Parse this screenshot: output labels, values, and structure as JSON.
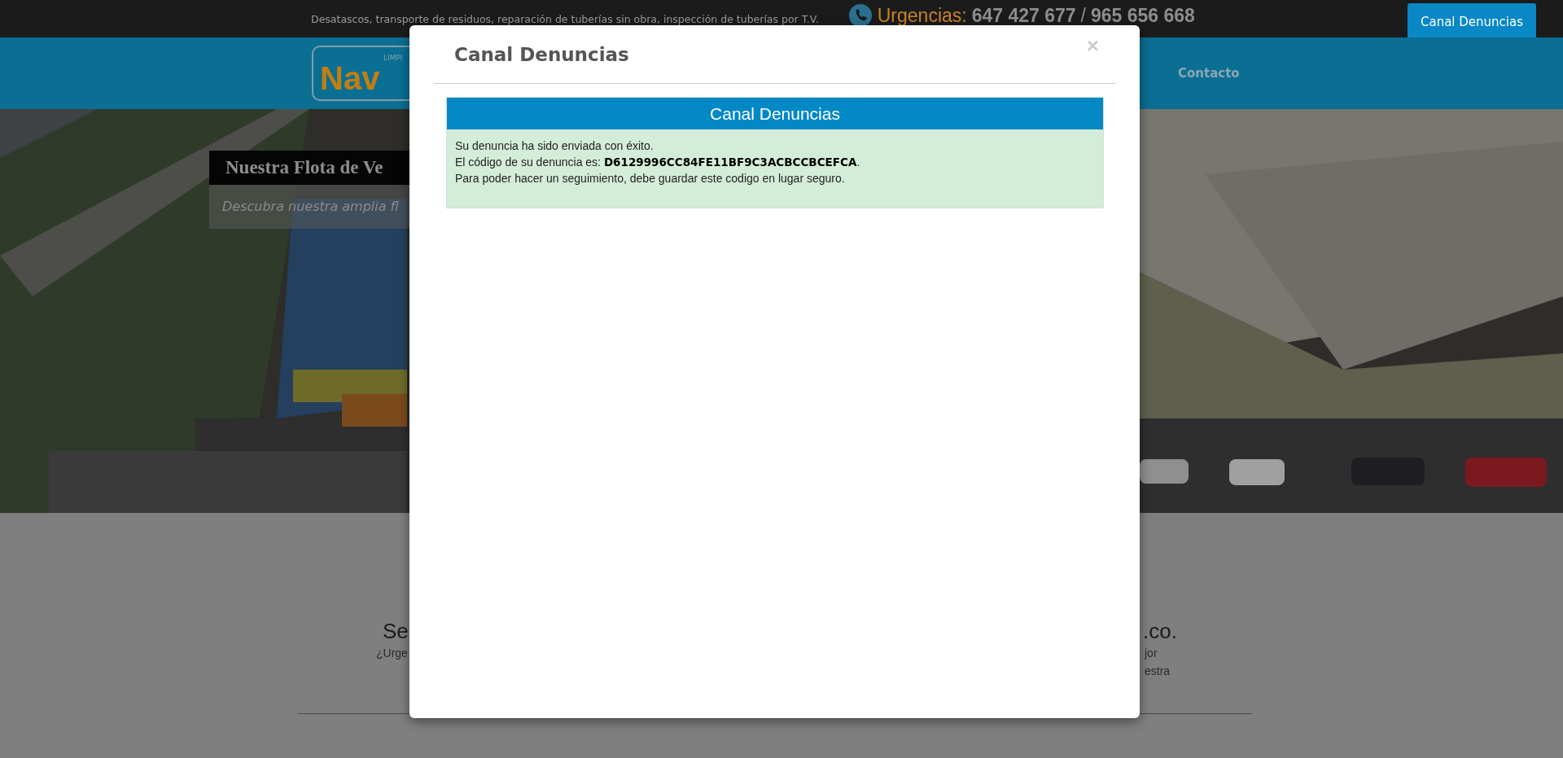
{
  "top_bar": {
    "tagline": "Desatascos, transporte de residuos, reparación de tuberías sin obra, inspección de tuberías por T.V.",
    "urgencias_label": "Urgencias:",
    "phones": [
      "647 427 677",
      "965 656 668"
    ],
    "separator": "/",
    "button": "Canal Denuncias"
  },
  "nav": {
    "logo_small": "LIMPI",
    "logo_text": "Nav",
    "items": [
      "Contacto"
    ]
  },
  "hero": {
    "caption_title": "Nuestra Flota de Ve",
    "caption_subtitle": "Descubra nuestra amplia fl"
  },
  "section": {
    "heading_left": "Se",
    "text_left": "¿Urge",
    "heading_right": ".co.",
    "text_right": [
      "jor",
      "estra"
    ]
  },
  "modal": {
    "title": "Canal Denuncias",
    "close": "×",
    "panel": {
      "header": "Canal Denuncias",
      "lines": [
        "Su denuncia ha sido enviada con éxito.",
        "El código de su denuncia es: **D6129996CC84FE11BF9C3ACBCCBCEFCA**.",
        "Para poder hacer un seguimiento, debe guardar este codigo en lugar seguro."
      ]
    }
  }
}
